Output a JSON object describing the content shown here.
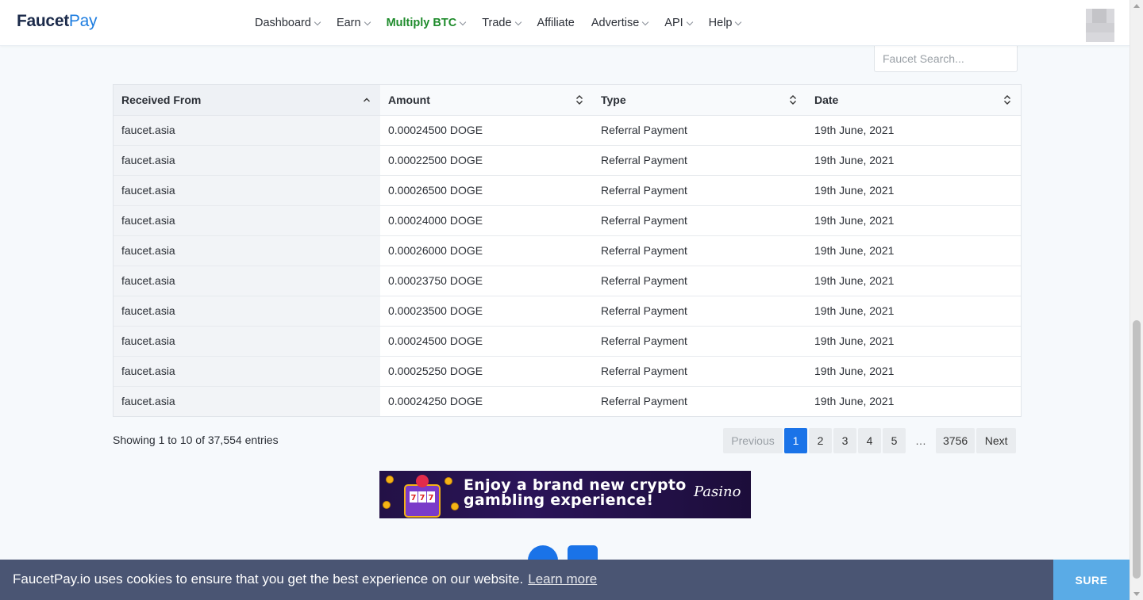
{
  "brand": {
    "name_part1": "Faucet",
    "name_part2": "Pay"
  },
  "nav": [
    {
      "label": "Dashboard",
      "dropdown": true,
      "active": false
    },
    {
      "label": "Earn",
      "dropdown": true,
      "active": false
    },
    {
      "label": "Multiply BTC",
      "dropdown": true,
      "active": true
    },
    {
      "label": "Trade",
      "dropdown": true,
      "active": false
    },
    {
      "label": "Affiliate",
      "dropdown": false,
      "active": false
    },
    {
      "label": "Advertise",
      "dropdown": true,
      "active": false
    },
    {
      "label": "API",
      "dropdown": true,
      "active": false
    },
    {
      "label": "Help",
      "dropdown": true,
      "active": false
    }
  ],
  "search": {
    "placeholder": "Faucet Search..."
  },
  "table": {
    "columns": [
      "Received From",
      "Amount",
      "Type",
      "Date"
    ],
    "sorted_column": "Received From",
    "sort_direction": "ascending",
    "rows": [
      [
        "faucet.asia",
        "0.00024500 DOGE",
        "Referral Payment",
        "19th June, 2021"
      ],
      [
        "faucet.asia",
        "0.00022500 DOGE",
        "Referral Payment",
        "19th June, 2021"
      ],
      [
        "faucet.asia",
        "0.00026500 DOGE",
        "Referral Payment",
        "19th June, 2021"
      ],
      [
        "faucet.asia",
        "0.00024000 DOGE",
        "Referral Payment",
        "19th June, 2021"
      ],
      [
        "faucet.asia",
        "0.00026000 DOGE",
        "Referral Payment",
        "19th June, 2021"
      ],
      [
        "faucet.asia",
        "0.00023750 DOGE",
        "Referral Payment",
        "19th June, 2021"
      ],
      [
        "faucet.asia",
        "0.00023500 DOGE",
        "Referral Payment",
        "19th June, 2021"
      ],
      [
        "faucet.asia",
        "0.00024500 DOGE",
        "Referral Payment",
        "19th June, 2021"
      ],
      [
        "faucet.asia",
        "0.00025250 DOGE",
        "Referral Payment",
        "19th June, 2021"
      ],
      [
        "faucet.asia",
        "0.00024250 DOGE",
        "Referral Payment",
        "19th June, 2021"
      ]
    ]
  },
  "pagination": {
    "info": "Showing 1 to 10 of 37,554 entries",
    "previous": "Previous",
    "next": "Next",
    "pages": [
      "1",
      "2",
      "3",
      "4",
      "5"
    ],
    "ellipsis": "…",
    "last": "3756",
    "current": "1"
  },
  "banner": {
    "line1": "Enjoy a brand new crypto",
    "line2": "gambling experience!",
    "brand": "Pasino"
  },
  "cookie": {
    "text": "FaucetPay.io uses cookies to ensure that you get the best experience on our website.",
    "link": "Learn more",
    "button": "SURE"
  },
  "colors": {
    "accent": "#1a73e8",
    "active_nav": "#1e8b2b",
    "cookie_bg": "#4a5573",
    "cookie_button": "#5aabe6"
  }
}
